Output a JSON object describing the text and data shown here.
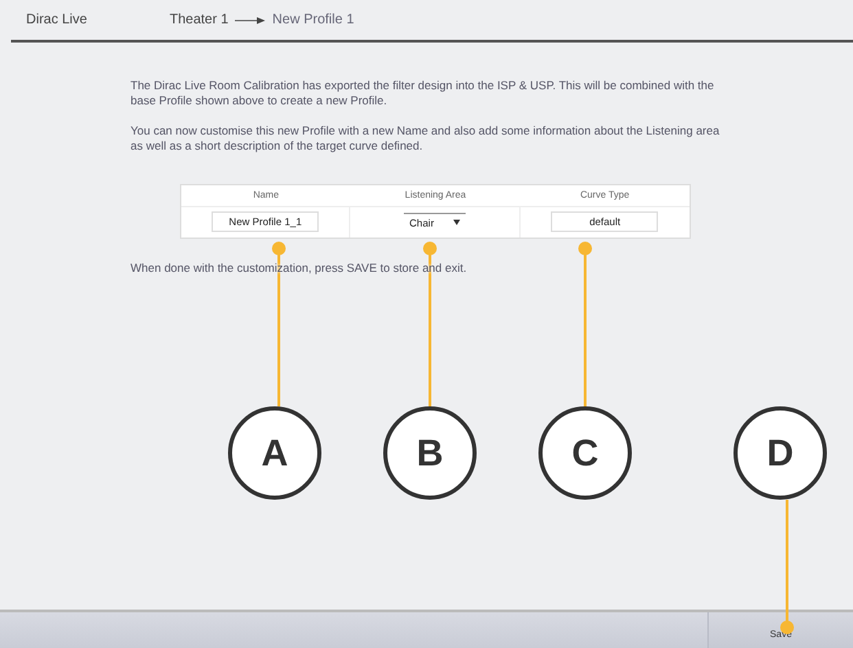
{
  "header": {
    "app_name": "Dirac Live",
    "breadcrumb": [
      "Theater 1",
      "New Profile 1"
    ]
  },
  "paragraphs": [
    "The Dirac Live Room Calibration has exported the filter design into the ISP & USP. This will be combined with the base Profile shown above to create a new Profile.",
    "You can now customise this new Profile with a new Name and also add some information about the Listening area as well as a short description of the target curve defined."
  ],
  "table": {
    "columns": [
      {
        "label": "Name",
        "kind": "text",
        "value": "New Profile 1_1"
      },
      {
        "label": "Listening Area",
        "kind": "dropdown",
        "value": "Chair"
      },
      {
        "label": "Curve Type",
        "kind": "text",
        "value": "default"
      }
    ]
  },
  "hint": "When done with the customization, press SAVE to store and exit.",
  "save_button": "Save",
  "callouts": [
    "A",
    "B",
    "C",
    "D"
  ]
}
